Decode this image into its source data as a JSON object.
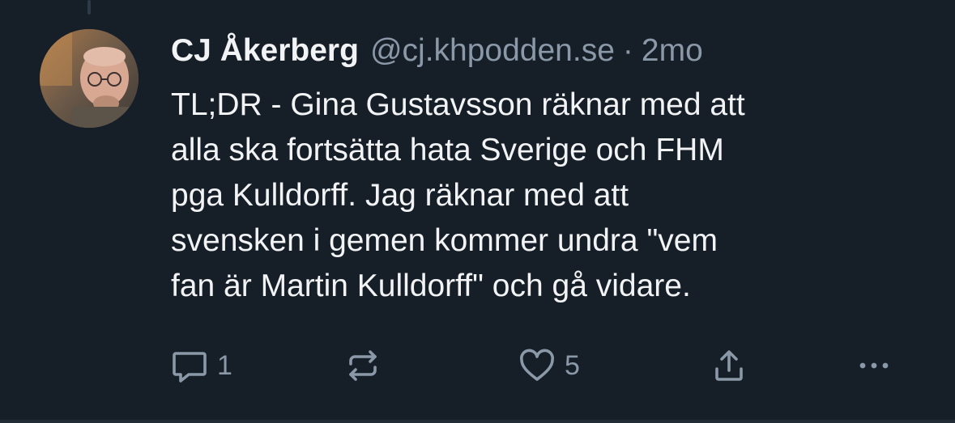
{
  "post": {
    "author": {
      "display_name": "CJ Åkerberg",
      "handle": "@cj.khpodden.se",
      "avatar": "profile-photo"
    },
    "separator": "·",
    "timestamp": "2mo",
    "text_lines": [
      "TL;DR - Gina Gustavsson räknar med att",
      "alla ska fortsätta hata Sverige och FHM",
      "pga Kulldorff. Jag räknar med att",
      "svensken i gemen kommer undra \"vem",
      "fan är Martin Kulldorff\" och gå vidare."
    ],
    "actions": {
      "reply": {
        "icon": "reply-icon",
        "count": "1"
      },
      "repost": {
        "icon": "repost-icon",
        "count": ""
      },
      "like": {
        "icon": "heart-icon",
        "count": "5"
      },
      "share": {
        "icon": "share-icon"
      },
      "more": {
        "icon": "more-icon"
      }
    }
  },
  "colors": {
    "background": "#161e27",
    "text_primary": "#f1f3f5",
    "text_secondary": "#8a98a8"
  }
}
